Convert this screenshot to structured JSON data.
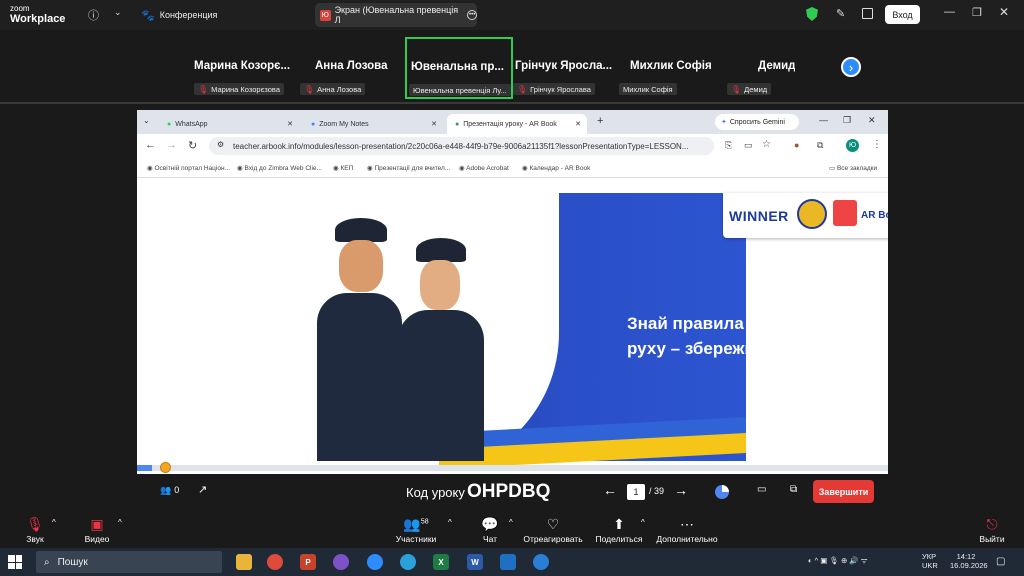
{
  "app": {
    "logo_top": "zoom",
    "logo_bottom": "Workplace"
  },
  "tabs": [
    {
      "label": "Конференция"
    },
    {
      "label": "Экран (Ювенальна превенція Л",
      "badge": "Ю"
    }
  ],
  "login_label": "Вход",
  "participants": [
    {
      "name": "Марина  Козорє...",
      "label": "Марина Козорєзова"
    },
    {
      "name": "Анна Лозова",
      "label": "Анна Лозова"
    },
    {
      "name": "Ювенальна  пр...",
      "label": "Ювенальна превенція Лу..."
    },
    {
      "name": "Грінчук  Яросла...",
      "label": "Грінчук Ярослава"
    },
    {
      "name": "Михлик Софія",
      "label": "Михлик Софія"
    },
    {
      "name": "Демид",
      "label": "Демид"
    }
  ],
  "browser": {
    "tabs": [
      "WhatsApp",
      "Zoom My Notes",
      "Презентація уроку - AR Book"
    ],
    "gemini": "Спросить Gemini",
    "url": "teacher.arbook.info/modules/lesson-presentation/2c20c06a-e448-44f9-b79e-9006a21135f1?lessonPresentationType=LESSON...",
    "bookmarks": [
      "Освітній портал Націон...",
      "Вхід до Zimbra Web Clie...",
      "КЕП",
      "Презентації для вчител...",
      "Adobe Acrobat",
      "Календар - AR Book"
    ],
    "all_bookmarks": "Все закладки",
    "profile": "Ю"
  },
  "slide": {
    "title_line1": "Знай правила дорожнього",
    "title_line2": "руху – збережи своє життя",
    "logo1": "WINNER",
    "logo2": "AR Book"
  },
  "lesson": {
    "viewers": "0",
    "code_label": "Код уроку",
    "code": "OHPDBQ",
    "page": "1",
    "total": "/ 39",
    "finish": "Завершити",
    "progress": 0.02
  },
  "zoombar": {
    "audio": "Звук",
    "video": "Видео",
    "participants": "Участники",
    "participants_count": "58",
    "chat": "Чат",
    "react": "Отреагировать",
    "share": "Поделиться",
    "more": "Дополнительно",
    "leave": "Выйти"
  },
  "taskbar": {
    "search": "Пошук",
    "lang1": "УКР",
    "lang2": "UKR",
    "time": "14:12",
    "date": "16.09.2026"
  }
}
